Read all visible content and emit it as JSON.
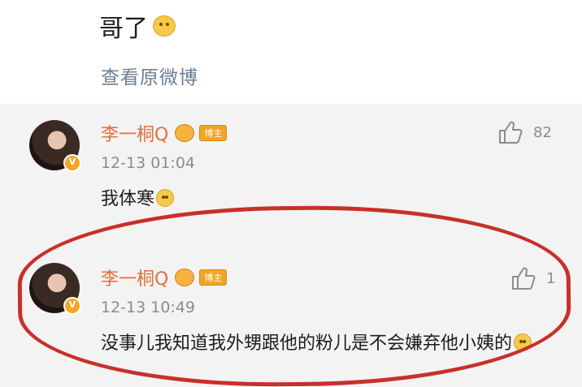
{
  "post": {
    "text_tail": "哥了",
    "view_original": "查看原微博"
  },
  "comments": [
    {
      "username": "李一桐Q",
      "level_badge": "博主",
      "timestamp": "12-13 01:04",
      "text": "我体寒",
      "likes": "82"
    },
    {
      "username": "李一桐Q",
      "level_badge": "博主",
      "timestamp": "12-13 10:49",
      "text": "没事儿我知道我外甥跟他的粉儿是不会嫌弃他小姨的",
      "likes": "1"
    }
  ],
  "colors": {
    "username": "#e0703a",
    "link": "#6b7c93",
    "highlight_ring": "#c8302a",
    "comment_bg": "#f3f3f3"
  }
}
